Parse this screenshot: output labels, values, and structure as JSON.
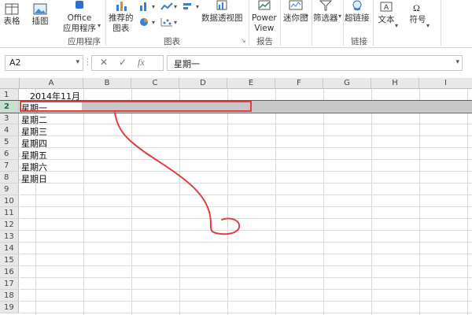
{
  "ribbon": {
    "buttons": {
      "table": "表格",
      "illustrations": "插图",
      "office_line1": "Office",
      "office_line2": "应用程序",
      "recommended_line1": "推荐的",
      "recommended_line2": "图表",
      "pivotchart": "数据透视图",
      "power_line1": "Power",
      "power_line2": "View",
      "sparklines": "迷你图",
      "filters": "筛选器",
      "hyperlink": "超链接",
      "text": "文本",
      "symbols": "符号"
    },
    "groups": {
      "apps": "应用程序",
      "charts": "图表",
      "reports": "报告",
      "links": "链接"
    }
  },
  "formula_bar": {
    "name_box": "A2",
    "cancel": "✕",
    "enter": "✓",
    "function": "fx",
    "content": "星期一"
  },
  "sheet": {
    "columns": [
      "A",
      "B",
      "C",
      "D",
      "E",
      "F",
      "G",
      "H",
      "I"
    ],
    "rows": [
      "1",
      "2",
      "3",
      "4",
      "5",
      "6",
      "7",
      "8",
      "9",
      "10",
      "11",
      "12",
      "13",
      "14",
      "15",
      "16",
      "17",
      "18",
      "19"
    ],
    "selected_row": "2",
    "cells": {
      "A1": "2014年11月",
      "A2": "星期一",
      "A3": "星期二",
      "A4": "星期三",
      "A5": "星期四",
      "A6": "星期五",
      "A7": "星期六",
      "A8": "星期日"
    }
  },
  "colors": {
    "excel_green": "#217346",
    "annotation_red": "#e33c3c",
    "selection_gray": "#c8c8c8"
  },
  "icons": [
    "table-icon",
    "illustrations-icon",
    "office-apps-icon",
    "recommended-charts-icon",
    "pivotchart-icon",
    "power-view-icon",
    "sparklines-icon",
    "filter-icon",
    "hyperlink-icon",
    "text-icon",
    "symbols-icon",
    "dropdown-arrow-icon"
  ]
}
